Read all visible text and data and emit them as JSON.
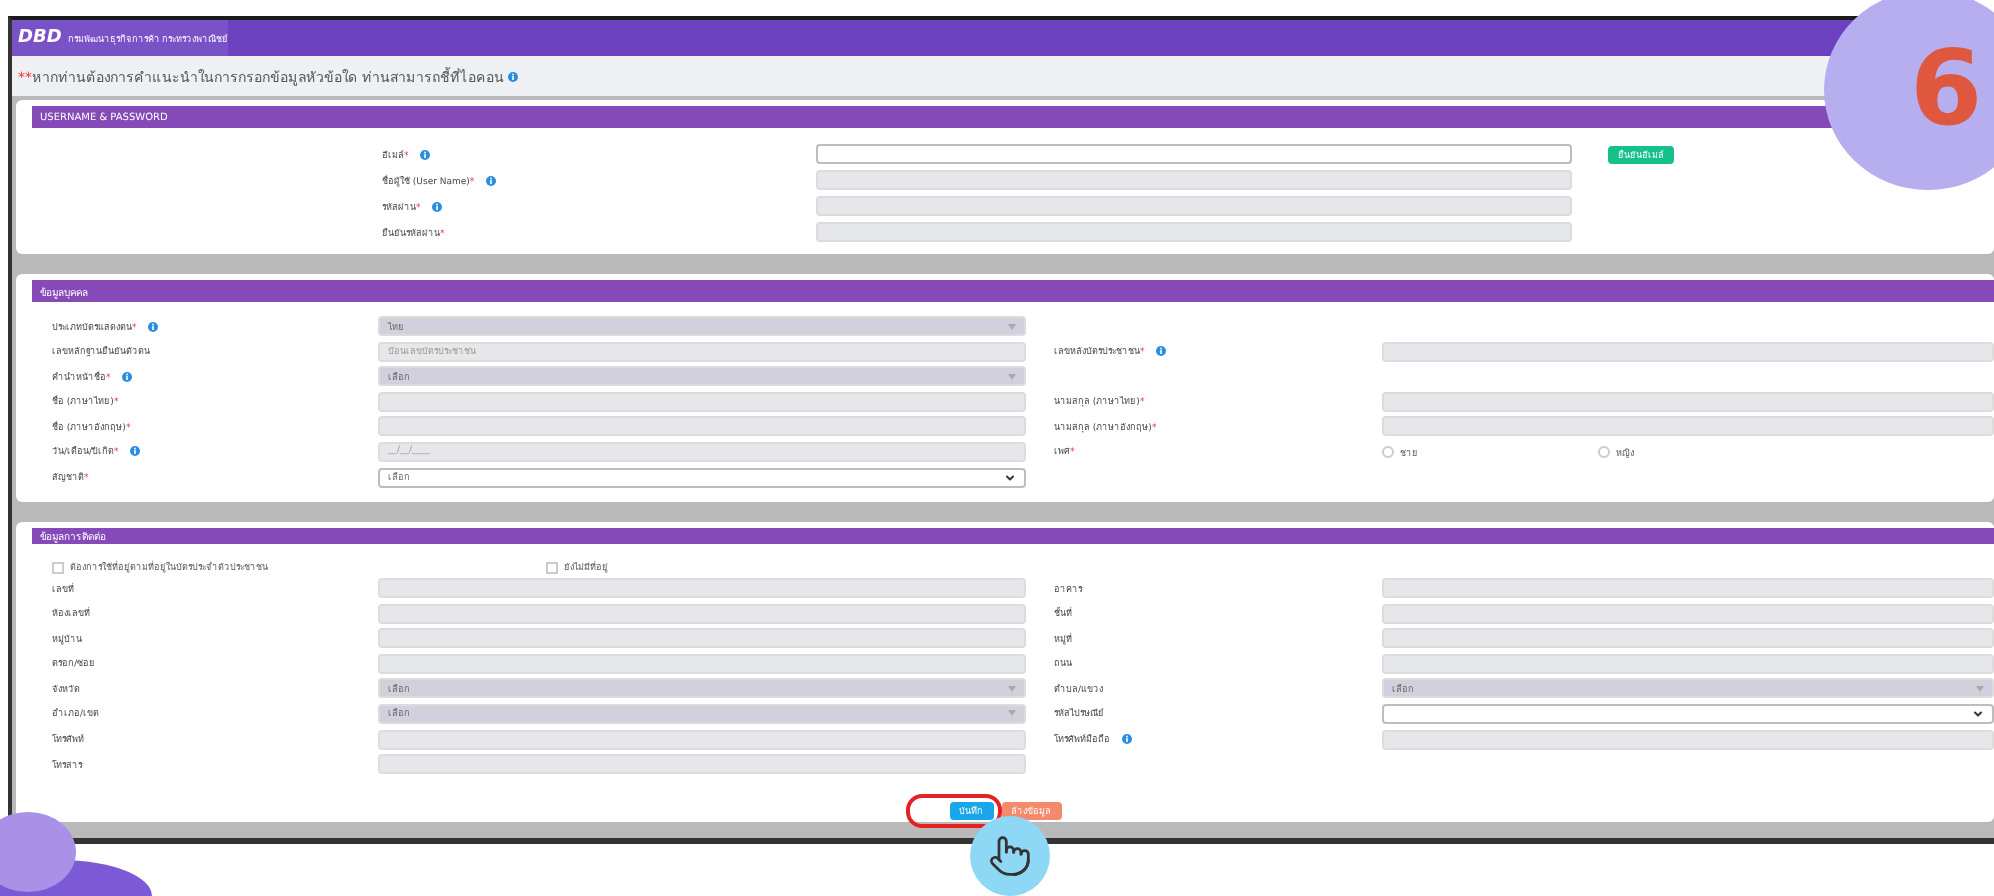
{
  "header": {
    "logo": "DBD",
    "org": "กรมพัฒนาธุรกิจการค้า กระทรวงพาณิชย์"
  },
  "notice": {
    "mark": "**",
    "text": "หากท่านต้องการคำแนะนำในการกรอกข้อมูลหัวข้อใด ท่านสามารถชี้ที่ไอคอน",
    "info": true
  },
  "step_badge": "6",
  "account": {
    "title": "USERNAME & PASSWORD",
    "check_button": "ยืนยันอีเมล์",
    "fields": [
      {
        "kind": "input",
        "label": "อีเมล์",
        "required_mark": "*",
        "info": true,
        "disabled": false
      },
      {
        "kind": "input",
        "label": "ชื่อผู้ใช้ (User Name)",
        "required_mark": "*",
        "info": true,
        "disabled": true
      },
      {
        "kind": "input",
        "label": "รหัสผ่าน",
        "required_mark": "*",
        "info": true,
        "disabled": true
      },
      {
        "kind": "input",
        "label": "ยืนยันรหัสผ่าน",
        "required_mark": "*",
        "info": false,
        "disabled": true
      }
    ]
  },
  "personal": {
    "title": "ข้อมูลบุคคล",
    "rows": [
      {
        "left": {
          "kind": "select",
          "label": "ประเภทบัตรแสดงตน",
          "required_mark": "*",
          "info": true,
          "disabled": true,
          "value": "ไทย"
        }
      },
      {
        "left": {
          "kind": "input",
          "label": "เลขหลักฐานยืนยันตัวตน",
          "info": false,
          "disabled": true,
          "placeholder": "ป้อนเลขบัตรประชาชน"
        },
        "right": {
          "kind": "input",
          "label": "เลขหลังบัตรประชาชน",
          "required_mark": "*",
          "info": true,
          "disabled": true
        }
      },
      {
        "left": {
          "kind": "select",
          "label": "คำนำหน้าชื่อ",
          "required_mark": "*",
          "info": true,
          "disabled": true,
          "value": "เลือก"
        }
      },
      {
        "left": {
          "kind": "input",
          "label": "ชื่อ (ภาษาไทย)",
          "required_mark": "*",
          "info": false,
          "disabled": true
        },
        "right": {
          "kind": "input",
          "label": "นามสกุล (ภาษาไทย)",
          "required_mark": "*",
          "info": false,
          "disabled": true
        }
      },
      {
        "left": {
          "kind": "input",
          "label": "ชื่อ (ภาษาอังกฤษ)",
          "required_mark": "*",
          "info": false,
          "disabled": true
        },
        "right": {
          "kind": "input",
          "label": "นามสกุล (ภาษาอังกฤษ)",
          "required_mark": "*",
          "info": false,
          "disabled": true
        }
      },
      {
        "left": {
          "kind": "input",
          "label": "วัน/เดือน/ปีเกิด",
          "required_mark": "*",
          "info": true,
          "disabled": true,
          "placeholder": "__/__/____"
        },
        "right": {
          "kind": "radio",
          "label": "เพศ",
          "required_mark": "*",
          "info": false,
          "options": [
            {
              "label": "ชาย",
              "selected": false
            },
            {
              "label": "หญิง",
              "selected": false
            }
          ]
        }
      },
      {
        "left": {
          "kind": "select",
          "label": "สัญชาติ",
          "required_mark": "*",
          "info": false,
          "disabled": false,
          "value": "เลือก"
        }
      }
    ]
  },
  "contact": {
    "title": "ข้อมูลการติดต่อ",
    "options": [
      {
        "label": "ต้องการใช้ที่อยู่ตามที่อยู่ในบัตรประจำตัวประชาชน",
        "checked": false
      },
      {
        "label": "ยังไม่มีที่อยู่",
        "checked": false
      }
    ],
    "rows": [
      {
        "left": {
          "kind": "input",
          "label": "เลขที่",
          "info": false,
          "disabled": true
        },
        "right": {
          "kind": "input",
          "label": "อาคาร",
          "info": false,
          "disabled": true
        }
      },
      {
        "left": {
          "kind": "input",
          "label": "ห้องเลขที่",
          "info": false,
          "disabled": true
        },
        "right": {
          "kind": "input",
          "label": "ชั้นที่",
          "info": false,
          "disabled": true
        }
      },
      {
        "left": {
          "kind": "input",
          "label": "หมู่บ้าน",
          "info": false,
          "disabled": true
        },
        "right": {
          "kind": "input",
          "label": "หมู่ที่",
          "info": false,
          "disabled": true
        }
      },
      {
        "left": {
          "kind": "input",
          "label": "ตรอก/ซอย",
          "info": false,
          "disabled": true
        },
        "right": {
          "kind": "input",
          "label": "ถนน",
          "info": false,
          "disabled": true
        }
      },
      {
        "left": {
          "kind": "select",
          "label": "จังหวัด",
          "info": false,
          "disabled": true,
          "value": "เลือก"
        },
        "right": {
          "kind": "select",
          "label": "ตำบล/แขวง",
          "info": false,
          "disabled": true,
          "value": "เลือก"
        }
      },
      {
        "left": {
          "kind": "select",
          "label": "อำเภอ/เขต",
          "info": false,
          "disabled": true,
          "value": "เลือก"
        },
        "right": {
          "kind": "select",
          "label": "รหัสไปรษณีย์",
          "info": false,
          "disabled": false
        }
      },
      {
        "left": {
          "kind": "input",
          "label": "โทรศัพท์",
          "info": false,
          "disabled": true
        },
        "right": {
          "kind": "input",
          "label": "โทรศัพท์มือถือ",
          "info": true,
          "disabled": true
        }
      },
      {
        "left": {
          "kind": "input",
          "label": "โทรสาร",
          "info": false,
          "disabled": true
        }
      }
    ]
  },
  "buttons": [
    {
      "label": "บันทึก",
      "kind": "primary",
      "highlighted": true
    },
    {
      "label": "ล้างข้อมูล",
      "kind": "reset",
      "highlighted": false
    }
  ]
}
